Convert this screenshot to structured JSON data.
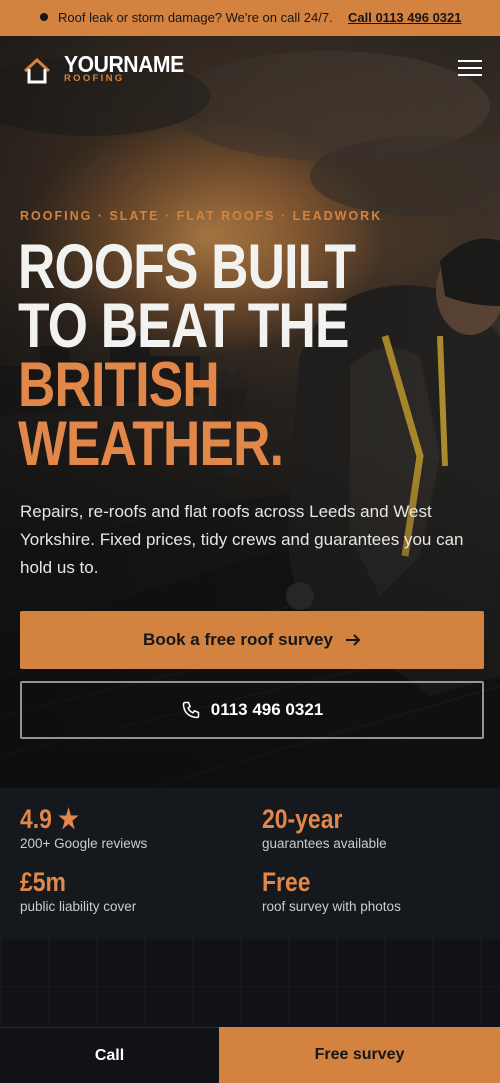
{
  "topbar": {
    "message": "Roof leak or storm damage? We're on call 24/7.",
    "phone_link": "Call 0113 496 0321"
  },
  "nav": {
    "logo_name": "YOURNAME",
    "logo_sub": "ROOFING",
    "menu_icon": "hamburger-menu-icon"
  },
  "hero": {
    "eyebrow": "ROOFING · SLATE · FLAT ROOFS · LEADWORK",
    "headline_white_1": "ROOFS BUILT",
    "headline_white_2": "TO BEAT THE",
    "headline_orange_1": "BRITISH",
    "headline_orange_2": "WEATHER.",
    "lead": "Repairs, re-roofs and flat roofs across Leeds and West Yorkshire. Fixed prices, tidy crews and guarantees you can hold us to.",
    "primary_button": "Book a free roof survey",
    "primary_icon": "arrow-right-icon",
    "secondary_button": "0113 496 0321",
    "secondary_icon": "phone-icon"
  },
  "stats": [
    {
      "value": "4.9",
      "icon": "star-icon",
      "label": "200+ Google reviews"
    },
    {
      "value": "20-year",
      "label": "guarantees available"
    },
    {
      "value": "£5m",
      "label": "public liability cover"
    },
    {
      "value": "Free",
      "label": "roof survey with photos"
    }
  ],
  "bottom_bar": {
    "call": "Call",
    "survey": "Free survey"
  },
  "colors": {
    "accent": "#d4823f",
    "headline_orange": "#e1874a",
    "dark": "#101215"
  }
}
